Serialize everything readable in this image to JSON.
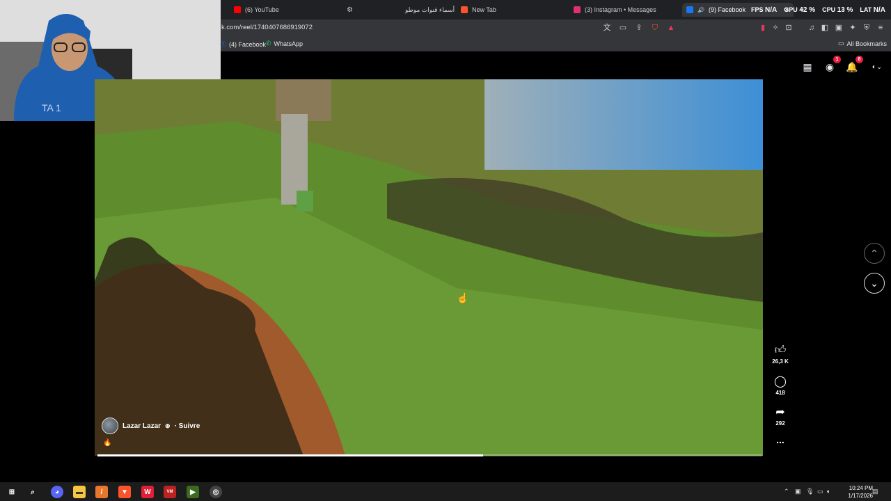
{
  "browser": {
    "tabs": [
      {
        "label": "(6) YouTube",
        "favicon": "youtube-icon",
        "color": "#ff0000"
      },
      {
        "label": "",
        "favicon": "settings-icon",
        "color": "#aaaaaa"
      },
      {
        "label": "أسماء قنوات موطو",
        "favicon": "",
        "color": ""
      },
      {
        "label": "New Tab",
        "favicon": "brave-icon",
        "color": "#fb542b"
      },
      {
        "label": "(3) Instagram • Messages",
        "favicon": "instagram-icon",
        "color": "#e1306c"
      },
      {
        "label": "(9) Facebook",
        "favicon": "facebook-icon",
        "color": "#1877f2"
      }
    ],
    "url": "k.com/reel/1740407686919072",
    "bookmarks": [
      {
        "label": "(4) Facebook",
        "icon": "facebook-icon"
      },
      {
        "label": "WhatsApp",
        "icon": "whatsapp-icon"
      }
    ],
    "all_bookmarks": "All Bookmarks"
  },
  "overlay_stats": {
    "fps_label": "FPS",
    "fps_value": "N/A",
    "gpu_label": "GPU",
    "gpu_value": "42 %",
    "cpu_label": "CPU",
    "cpu_value": "13 %",
    "lat_label": "LAT",
    "lat_value": "N/A"
  },
  "facebook": {
    "messenger_badge": "1",
    "notifications_badge": "8"
  },
  "reel": {
    "author": "Lazar Lazar",
    "follow_label": "· Suivre",
    "progress": 0.58,
    "likes": "26,3 K",
    "comments": "418",
    "shares": "292",
    "more": "..."
  },
  "taskbar": {
    "time": "10:24 PM",
    "date": "1/17/2026"
  }
}
